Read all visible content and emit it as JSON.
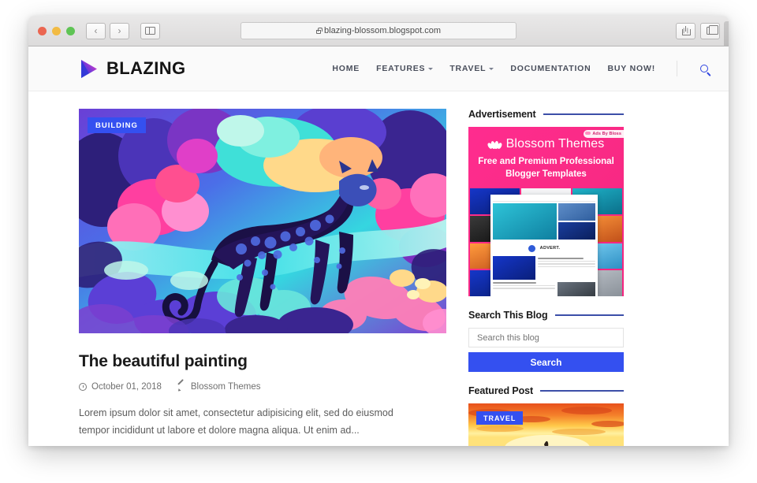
{
  "browser": {
    "url": "blazing-blossom.blogspot.com",
    "lock_icon": "lock-icon",
    "back_glyph": "‹",
    "forward_glyph": "›",
    "new_tab_glyph": "+",
    "window_controls": [
      "close",
      "minimize",
      "maximize"
    ]
  },
  "site": {
    "brand": "BLAZING",
    "nav": [
      {
        "label": "HOME",
        "has_dropdown": false
      },
      {
        "label": "FEATURES",
        "has_dropdown": true
      },
      {
        "label": "TRAVEL",
        "has_dropdown": true
      },
      {
        "label": "DOCUMENTATION",
        "has_dropdown": false
      },
      {
        "label": "BUY NOW!",
        "has_dropdown": false
      }
    ],
    "search_icon": "search-icon",
    "accent_color": "#3450f0",
    "header_bg": "#fafafa"
  },
  "post": {
    "category_badge": "BUILDING",
    "title": "The beautiful painting",
    "date": "October 01, 2018",
    "author": "Blossom Themes",
    "excerpt": "Lorem ipsum dolor sit amet, consectetur adipisicing elit, sed do eiusmod tempor incididunt ut labore et dolore magna aliqua. Ut enim ad..."
  },
  "sidebar": {
    "advertisement": {
      "title": "Advertisement",
      "tag": "Ads By Bloss",
      "brand": "Blossom Themes",
      "headline_line1": "Free and Premium Professional",
      "headline_line2": "Blogger Templates",
      "advert_label": "ADVERT."
    },
    "search": {
      "title": "Search This Blog",
      "placeholder": "Search this blog",
      "value": "",
      "button_label": "Search"
    },
    "featured": {
      "title": "Featured Post",
      "badge": "TRAVEL"
    }
  }
}
